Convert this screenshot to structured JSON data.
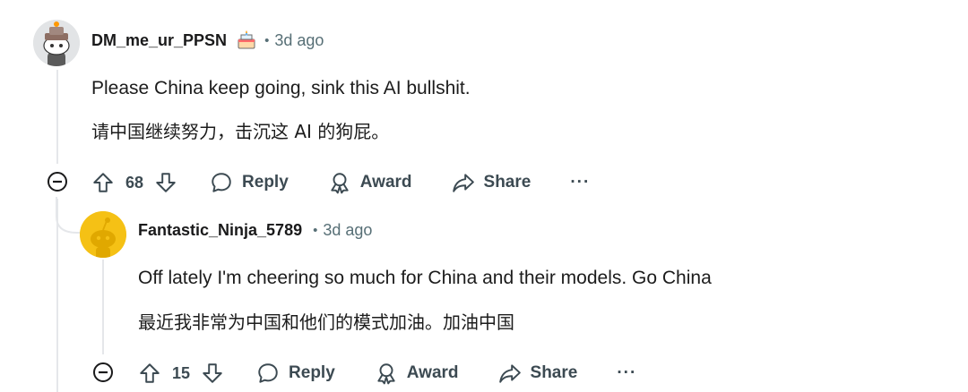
{
  "comments": [
    {
      "username": "DM_me_ur_PPSN",
      "flair_icon": "cake-icon",
      "separator": "•",
      "time": "3d ago",
      "body_en": "Please China keep going, sink this AI bullshit.",
      "body_zh": "请中国继续努力，击沉这 AI 的狗屁。",
      "score": "68",
      "reply_label": "Reply",
      "award_label": "Award",
      "share_label": "Share",
      "more_label": "···",
      "avatar_color": "#e2e4e6"
    },
    {
      "username": "Fantastic_Ninja_5789",
      "separator": "•",
      "time": "3d ago",
      "body_en": "Off lately I'm cheering so much for China and their models. Go China",
      "body_zh": "最近我非常为中国和他们的模式加油。加油中国",
      "score": "15",
      "reply_label": "Reply",
      "award_label": "Award",
      "share_label": "Share",
      "more_label": "···",
      "avatar_color": "#f5c115"
    }
  ],
  "colors": {
    "text": "#1a1a1b",
    "muted": "#576f76",
    "thread": "#e5e7ea"
  }
}
